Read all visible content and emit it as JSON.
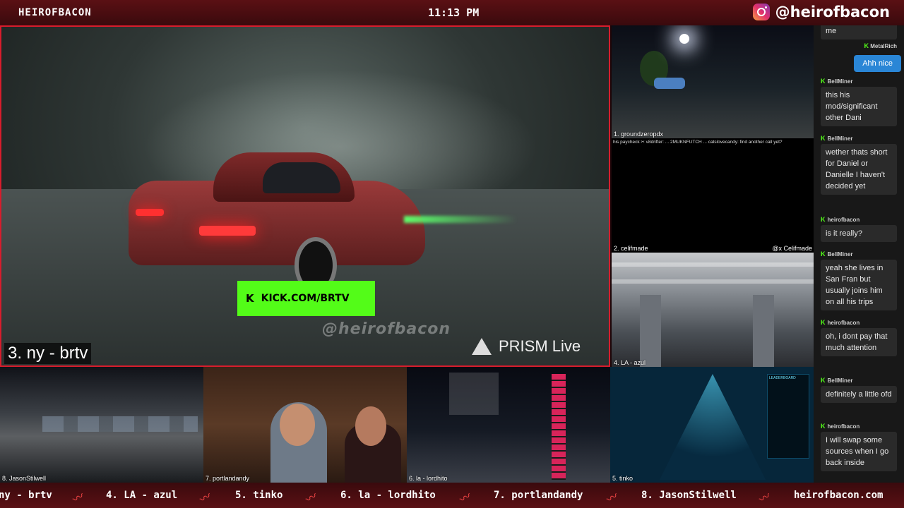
{
  "header": {
    "brand": "HEIROFBACON",
    "time": "11:13 PM",
    "instagram_handle": "@heirofbacon",
    "instagram_icon": "instagram-icon"
  },
  "main_feed": {
    "label": "3. ny - brtv",
    "kick_banner": "KICK.COM/BRTV",
    "kick_logo": "K",
    "watermark": "@heirofbacon",
    "prism": "PRISM Live"
  },
  "side_feeds": {
    "feed1_label": "1. groundzeropdx",
    "feed1_ticker": "his paycheck ✂ v8drifter: ... 2MUKNFUTCH ... catslovecandy: find another call yet?",
    "feed2_label": "2. celifmade",
    "feed2_tag": "@x Celifmade",
    "feed4_label": "4. LA - azul"
  },
  "bottom_feeds": {
    "feed8_label": "8. JasonStilwell",
    "feed7_label": "7. portlandandy",
    "feed6_label": "6. la - lordhito",
    "feed5_label": "5. tinko",
    "leaderboard_title": "LEADERBOARD"
  },
  "chat": {
    "top_fragment": "me",
    "messages": [
      {
        "user": "MetalRich",
        "text": "Ahh nice",
        "own": true
      },
      {
        "user": "BellMiner",
        "text": "this his mod/significant other Dani"
      },
      {
        "user": "BellMiner",
        "text": "wether thats short for Daniel or Danielle I haven't decided yet"
      },
      {
        "user": "heirofbacon",
        "text": "is it really?"
      },
      {
        "user": "BellMiner",
        "text": "yeah she lives in San Fran but usually joins him on all his trips"
      },
      {
        "user": "heirofbacon",
        "text": "oh, i dont pay that much attention"
      },
      {
        "user": "BellMiner",
        "text": "definitely a little ofd"
      },
      {
        "user": "heirofbacon",
        "text": "I will swap some sources when I go back inside"
      }
    ]
  },
  "ticker": {
    "items": [
      "ny - brtv",
      "4. LA - azul",
      "5. tinko",
      "6. la - lordhito",
      "7. portlandandy",
      "8. JasonStilwell",
      "heirofbacon.com"
    ],
    "separator_icon": "bacon-icon"
  },
  "colors": {
    "accent_red": "#d81c2c",
    "kick_green": "#53fc18",
    "chat_own_blue": "#2a86d6"
  }
}
